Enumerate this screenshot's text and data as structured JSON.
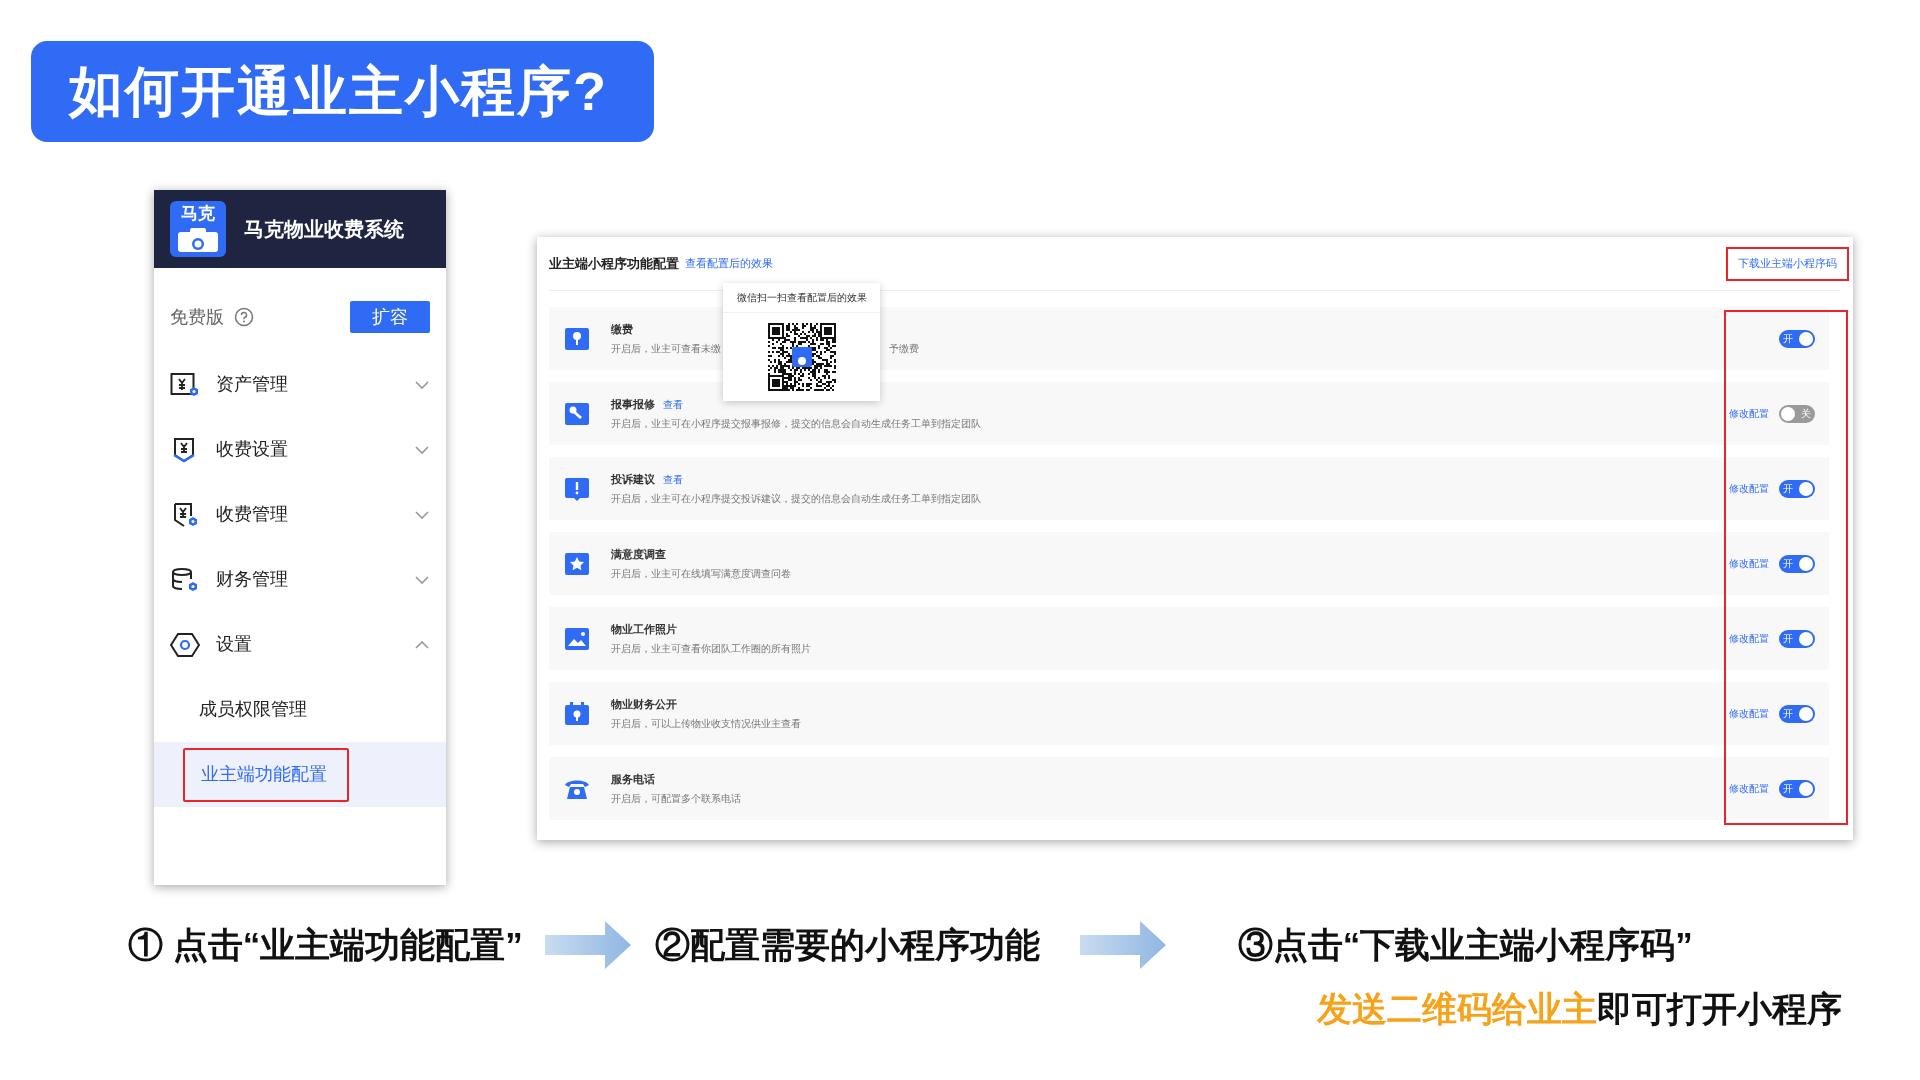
{
  "title": "如何开通业主小程序?",
  "sidebar": {
    "app_name": "马克物业收费系统",
    "logo_text": "马克",
    "plan": "免费版",
    "expand_button": "扩容",
    "items": [
      {
        "label": "资产管理",
        "expanded": false
      },
      {
        "label": "收费设置",
        "expanded": false
      },
      {
        "label": "收费管理",
        "expanded": false
      },
      {
        "label": "财务管理",
        "expanded": false
      },
      {
        "label": "设置",
        "expanded": true,
        "children": [
          {
            "label": "成员权限管理",
            "selected": false
          },
          {
            "label": "业主端功能配置",
            "selected": true
          }
        ]
      }
    ]
  },
  "config_panel": {
    "title": "业主端小程序功能配置",
    "preview_link": "查看配置后的效果",
    "download_link": "下载业主端小程序码",
    "popup": {
      "title": "微信扫一扫查看配置后的效果"
    },
    "features": [
      {
        "name": "缴费",
        "description": "开启后，业主可查看未缴",
        "description_tail": "予缴费",
        "on": true,
        "toggle_label": "开"
      },
      {
        "name": "报事报修",
        "view_link": "查看",
        "description": "开启后，业主可在小程序提交报事报修，提交的信息会自动生成任务工单到指定团队",
        "edit_link": "修改配置",
        "on": false,
        "toggle_label": "关"
      },
      {
        "name": "投诉建议",
        "view_link": "查看",
        "description": "开启后，业主可在小程序提交投诉建议，提交的信息会自动生成任务工单到指定团队",
        "edit_link": "修改配置",
        "on": true,
        "toggle_label": "开"
      },
      {
        "name": "满意度调查",
        "description": "开启后，业主可在线填写满意度调查问卷",
        "edit_link": "修改配置",
        "on": true,
        "toggle_label": "开"
      },
      {
        "name": "物业工作照片",
        "description": "开启后，业主可查看你团队工作圈的所有照片",
        "edit_link": "修改配置",
        "on": true,
        "toggle_label": "开"
      },
      {
        "name": "物业财务公开",
        "description": "开启后，可以上传物业收支情况供业主查看",
        "edit_link": "修改配置",
        "on": true,
        "toggle_label": "开"
      },
      {
        "name": "服务电话",
        "description": "开启后，可配置多个联系电话",
        "edit_link": "修改配置",
        "on": true,
        "toggle_label": "开"
      }
    ]
  },
  "steps": [
    "① 点击“业主端功能配置”",
    "②配置需要的小程序功能",
    "③点击“下载业主端小程序码”"
  ],
  "note": {
    "highlight": "发送二维码给业主",
    "rest": "即可打开小程序"
  }
}
